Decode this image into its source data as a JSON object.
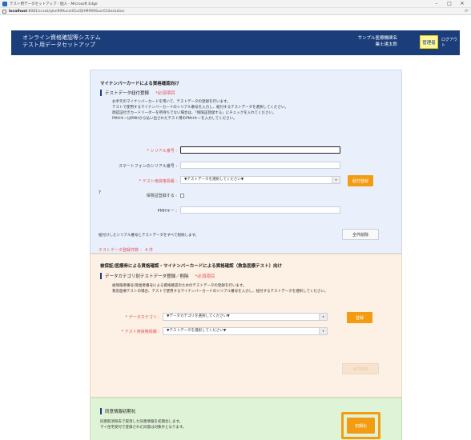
{
  "browser": {
    "window_title": "テスト用データセットアップ - 個人 - Microsoft Edge",
    "url_host": "localhost",
    "url_rest": ":8081/ccsat/qlon999ucoi01u/QHM999Susr01iteslution",
    "reader_icon": "A⁰",
    "win_min": "–",
    "win_max": "□",
    "win_close": "✕"
  },
  "header": {
    "system_title_line1": "オンライン資格確認等システム",
    "system_title_line2": "テスト用データセットアップ",
    "org_line1": "サンプル医療機関名",
    "org_line2": "業士達太郎",
    "role_badge": "管理者",
    "logout_label": "ログアウト"
  },
  "section1": {
    "title": "マイナンバーカードによる資格確認向け",
    "subtitle": "テストデータ紐付登録",
    "required_note": "*必須項目",
    "desc": [
      "お手元のマイナンバーカードを用いて、テストデータの登録を行います。",
      "テストで使用するマイナンバーカードのシリアル番号を入力し、紐付するテストデータを選択してください。",
      "顔認証付きカードリーダーを所持ちでない場合は、「保険証登録する」にチェックを入れてください。",
      "PMHキーはPMHから払い出されたテスト用のPMHキーを入力してください。"
    ],
    "serial_label": "* シリアル番号 :",
    "smartphone_label": "スマートフォンのシリアル番号 :",
    "testdata_label": "* テスト用資格情報 :",
    "testdata_select": "▼テストデータを選択してください▼",
    "register_button": "紐付登録",
    "help_icon": "?",
    "insurance_label": "保険証登録する :",
    "pmh_label": "PMHキー :",
    "delete_note": "紐付けしたシリアル番号とテストデータをすべて削除します。",
    "delete_all_button": "全件削除",
    "count_label": "テストデータ登録件数 ： 4 件"
  },
  "section2": {
    "title": "被保証/医療券による資格確認・マイナンバーカードによる資格確認（救急医療テスト）向け",
    "subtitle": "データカテゴリ別テストデータ登録／削除",
    "required_note": "*必須項目",
    "desc": [
      "被保険者番号/受給者番号による資格確認のためのテストデータの登録を行います。",
      "救急医療テストの場合、テストで使用するマイナンバーカードのシリアル番号を入力し、紐付するテストデータを選択してください。"
    ],
    "category_label": "* データカテゴリ :",
    "category_select": "▼データカテゴリを選択してください▼",
    "register_button": "登録",
    "testdata_label": "* テスト用資格情報 :",
    "testdata_select": "▼テストデータを選択してください▼",
    "delete_button": "全件削除"
  },
  "section3": {
    "subtitle": "同意情報初期化",
    "desc": [
      "同意取消除去で取消した同意情報を初期化します。",
      "マイ住宅受付で登録された同意は対象外となります。"
    ],
    "init_button": "初期化"
  },
  "colors": {
    "header_bg": "#1b3e7a",
    "accent_orange": "#f39c12",
    "section1_bg": "#eaf0fb",
    "section2_bg": "#fdf0e4",
    "section3_bg": "#dff3d6",
    "required_red": "#e05050"
  }
}
